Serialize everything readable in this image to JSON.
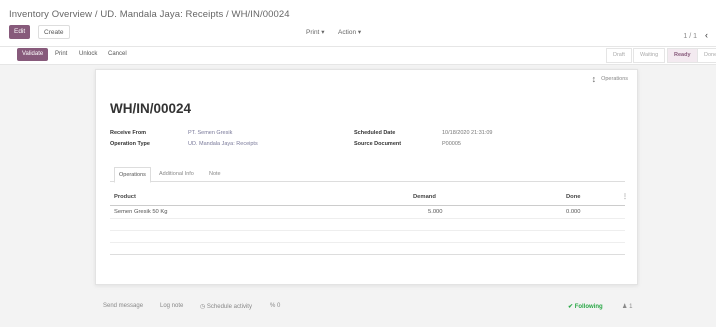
{
  "breadcrumb": "Inventory Overview / UD. Mandala Jaya: Receipts / WH/IN/00024",
  "controls": {
    "edit": "Edit",
    "create": "Create",
    "print": "Print",
    "action": "Action",
    "pager": "1 / 1"
  },
  "actionbar": {
    "validate": "Validate",
    "print": "Print",
    "unlock": "Unlock",
    "cancel": "Cancel",
    "statuses": [
      "Draft",
      "Waiting",
      "Ready",
      "Done"
    ],
    "active_status": "Ready"
  },
  "sheet": {
    "operations_button": "Operations",
    "title": "WH/IN/00024",
    "fields": {
      "receive_from_label": "Receive From",
      "receive_from_value": "PT. Semen Gresik",
      "operation_type_label": "Operation Type",
      "operation_type_value": "UD. Mandala Jaya: Receipts",
      "scheduled_date_label": "Scheduled Date",
      "scheduled_date_value": "10/18/2020 21:31:09",
      "source_document_label": "Source Document",
      "source_document_value": "P00005"
    },
    "tabs": [
      "Operations",
      "Additional Info",
      "Note"
    ],
    "table": {
      "headers": [
        "Product",
        "Demand",
        "Done"
      ],
      "rows": [
        {
          "product": "Semen Gresik 50 Kg",
          "demand": "5.000",
          "done": "0.000"
        }
      ]
    }
  },
  "chatter": {
    "send_message": "Send message",
    "log_note": "Log note",
    "schedule_activity": "Schedule activity",
    "attachments": "0",
    "following": "Following",
    "followers": "1"
  },
  "colors": {
    "primary": "#875a7b",
    "following": "#28a745"
  }
}
